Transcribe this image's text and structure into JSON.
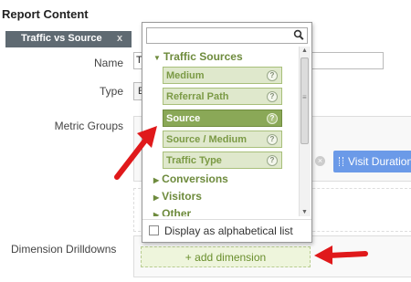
{
  "report": {
    "title": "Report Content",
    "tab_label": "Traffic vs Source",
    "tab_close": "x"
  },
  "form": {
    "name_label": "Name",
    "name_value": "T",
    "type_label": "Type",
    "type_value": "E",
    "metric_groups_label": "Metric Groups",
    "dimension_drilldowns_label": "Dimension Drilldowns"
  },
  "metric_chip": {
    "label": "Visit Duration"
  },
  "add_dimension": {
    "label": "+ add dimension"
  },
  "dropdown": {
    "search_value": "",
    "categories": [
      {
        "label": "Traffic Sources",
        "expanded": true
      },
      {
        "label": "Conversions",
        "expanded": false
      },
      {
        "label": "Visitors",
        "expanded": false
      },
      {
        "label": "Other",
        "expanded": false
      }
    ],
    "items": [
      {
        "label": "Medium",
        "help": "?",
        "selected": false
      },
      {
        "label": "Referral Path",
        "help": "?",
        "selected": false
      },
      {
        "label": "Source",
        "help": "?",
        "selected": true
      },
      {
        "label": "Source / Medium",
        "help": "?",
        "selected": false
      },
      {
        "label": "Traffic Type",
        "help": "?",
        "selected": false
      }
    ],
    "alphabetical_label": "Display as alphabetical list",
    "alphabetical_checked": false
  },
  "colors": {
    "accent_green": "#8aa857",
    "item_bg": "#dfe8cc",
    "category_text": "#6e8b3d",
    "chip_blue": "#6b9ae8",
    "annotation_arrow": "#e0191b",
    "tab_bg": "#5f6a72"
  },
  "icons": {
    "search": "search-icon",
    "help": "help-icon",
    "expand": "triangle-icon",
    "arrow": "red-arrow-annotation"
  }
}
